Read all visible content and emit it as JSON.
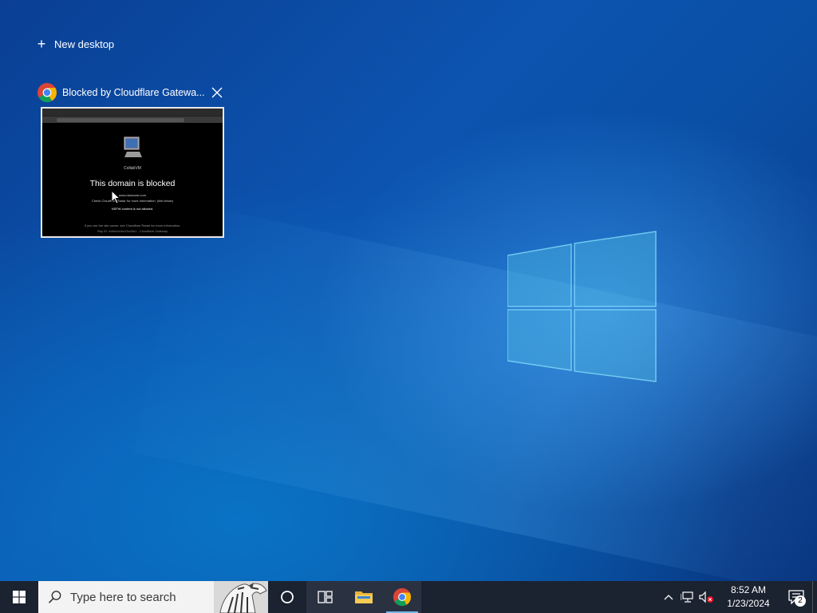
{
  "task_view": {
    "new_desktop_label": "New desktop",
    "window": {
      "app_icon": "chrome-icon",
      "title": "Blocked by Cloudflare Gatewa...",
      "thumbnail": {
        "vm_label": "CollabVM",
        "heading": "This domain is blocked",
        "line1": "www.dashcast.com",
        "line2": "Check Cloudflare Radar for more information. (link below)",
        "line3": "NSFW content is not allowed.",
        "line4": "If you are the site owner, see Cloudflare Radar for more information.",
        "line5": "Ray ID: 849a1c0ec23cd3e1 - Cloudflare Gateway"
      }
    }
  },
  "taskbar": {
    "search_placeholder": "Type here to search",
    "pinned": [
      {
        "name": "cortana",
        "icon": "circle-icon"
      },
      {
        "name": "task-view",
        "icon": "task-view-icon"
      },
      {
        "name": "file-explorer",
        "icon": "folder-icon"
      },
      {
        "name": "chrome",
        "icon": "chrome-icon"
      }
    ],
    "clock": {
      "time": "8:52 AM",
      "date": "1/23/2024"
    },
    "notification_count": "2"
  },
  "colors": {
    "taskbar": "#1b2230",
    "accent": "#76b9ed",
    "wallpaper": "#0c54b0"
  }
}
